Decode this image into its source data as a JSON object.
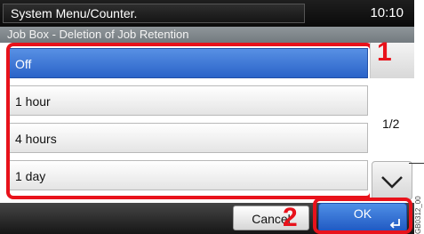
{
  "header": {
    "title": "System Menu/Counter.",
    "time": "10:10"
  },
  "subtitle": "Job Box - Deletion of Job Retention",
  "options": [
    {
      "label": "Off",
      "selected": true
    },
    {
      "label": "1 hour",
      "selected": false
    },
    {
      "label": "4 hours",
      "selected": false
    },
    {
      "label": "1 day",
      "selected": false
    }
  ],
  "pager": {
    "indicator": "1/2"
  },
  "buttons": {
    "cancel": "Cancel",
    "ok": "OK"
  },
  "callouts": {
    "first": "1",
    "second": "2"
  },
  "figure_code": "GB0312_00",
  "colors": {
    "selection": "#3a73d6",
    "highlight": "#e8121b"
  },
  "icons": {
    "scroll_up": "chevron-up-icon",
    "scroll_down": "chevron-down-icon",
    "ok": "enter-icon"
  }
}
